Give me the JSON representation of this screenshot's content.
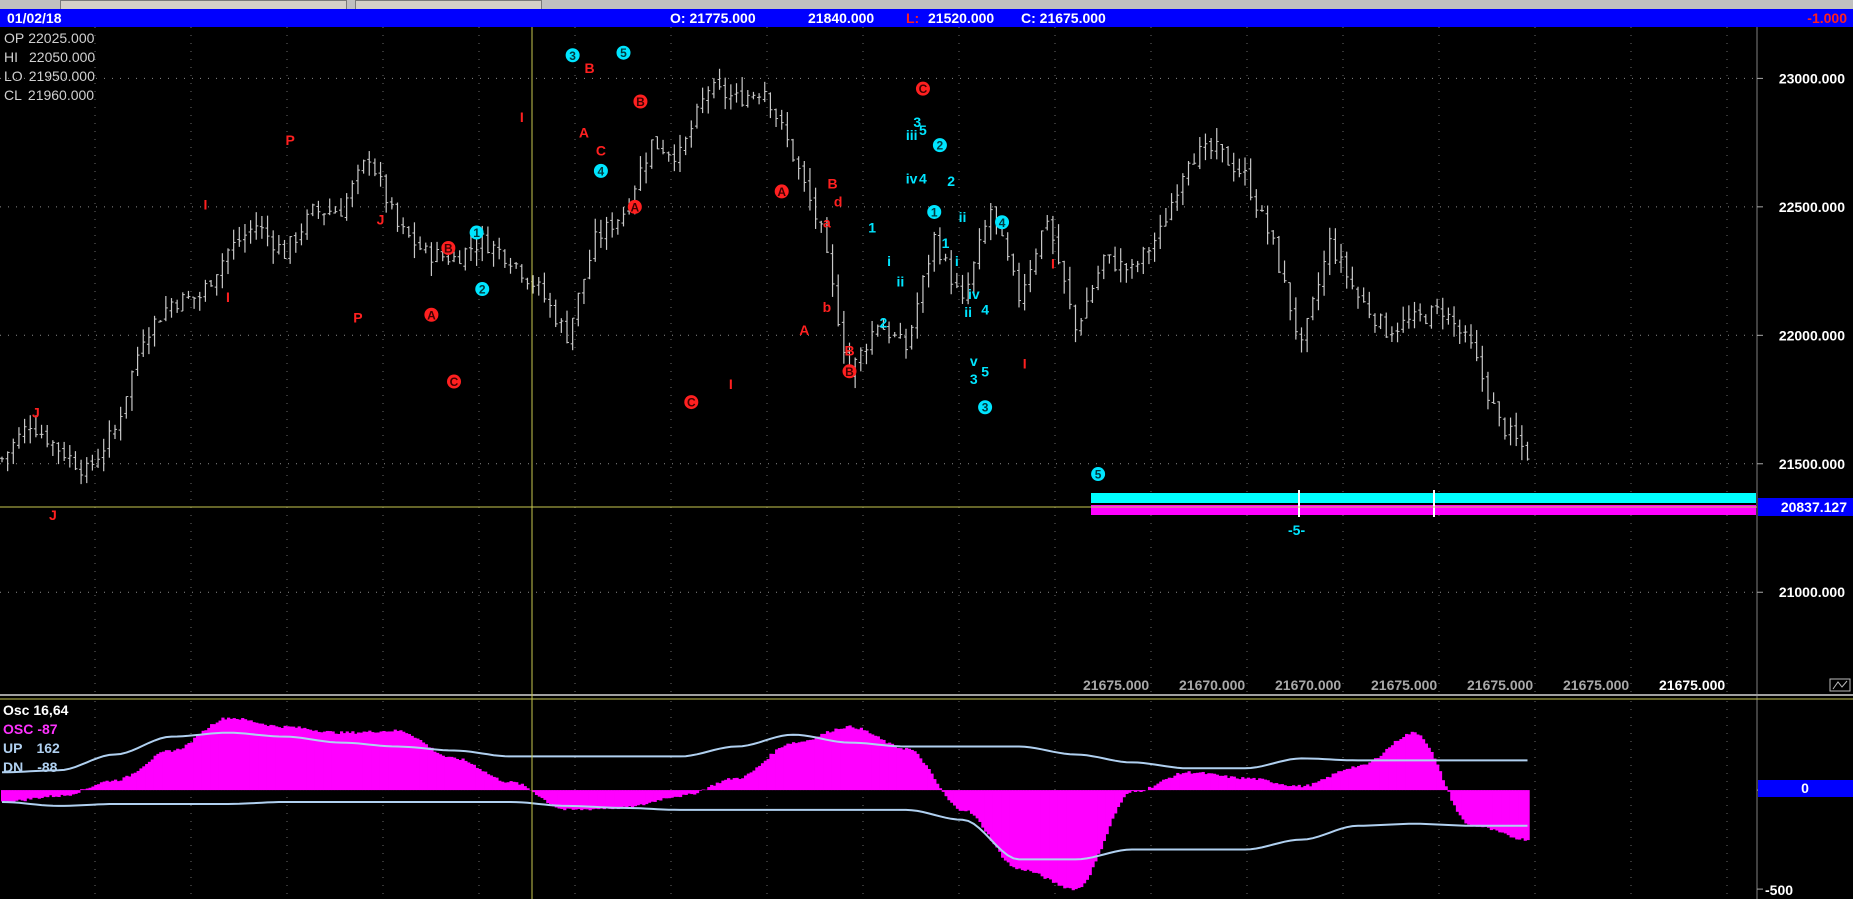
{
  "header": {
    "date": "01/02/18",
    "open": "O: 21775.000",
    "high": "21840.000",
    "low_label": "L:",
    "low": "21520.000",
    "close": "C: 21675.000",
    "change": "-1.000"
  },
  "info": [
    {
      "label": "OP",
      "value": "22025.000"
    },
    {
      "label": "HI",
      "value": "22050.000"
    },
    {
      "label": "LO",
      "value": "21950.000"
    },
    {
      "label": "CL",
      "value": "21960.000"
    }
  ],
  "bottom_values": [
    "21675.000",
    "21670.000",
    "21670.000",
    "21675.000",
    "21675.000",
    "21675.000",
    "21675.000"
  ],
  "osc_panel": {
    "title": "Osc 16,64",
    "rows": [
      {
        "label": "OSC",
        "value": "-87",
        "color": "#ff33ff"
      },
      {
        "label": "UP",
        "value": "162",
        "color": "#b0d0f0"
      },
      {
        "label": "DN",
        "value": "-88",
        "color": "#b0d0f0"
      }
    ],
    "zero_label": "0",
    "min_label": "-500"
  },
  "crosshair_price": "20837.127",
  "projection_label": "-5-",
  "colors": {
    "header_bg": "#0000ff",
    "price_bars": "#c8c8c8",
    "wave_red": "#ff2020",
    "wave_cyan": "#00e5ff",
    "osc_fill": "#ff00ff",
    "osc_bands": "#b0d0f0",
    "crosshair": "#c8c850"
  },
  "chart_data": [
    {
      "type": "line",
      "title": "",
      "ylim": [
        20600,
        23200
      ],
      "yticks": [
        "23000.000",
        "22500.000",
        "22000.000",
        "21500.000",
        "21000.000"
      ],
      "x": [
        0,
        5,
        10,
        15,
        20,
        25,
        30,
        35,
        40,
        45,
        50,
        55,
        60,
        65,
        70,
        75,
        80,
        85,
        90,
        95,
        100,
        105,
        110,
        115,
        120,
        125,
        130,
        135,
        140,
        145,
        150,
        155,
        160,
        165,
        170,
        175,
        180,
        185,
        190,
        195,
        200,
        205,
        210,
        215,
        220,
        225,
        230,
        235,
        240,
        245,
        250,
        255,
        260,
        265,
        270
      ],
      "series": [
        {
          "values": [
            21520,
            21660,
            21560,
            21470,
            21630,
            22000,
            22130,
            22150,
            22330,
            22430,
            22320,
            22480,
            22490,
            22700,
            22420,
            22320,
            22300,
            22370,
            22300,
            22180,
            22000,
            22370,
            22480,
            22750,
            22700,
            22960,
            22920,
            22960,
            22700,
            22400,
            21850,
            22050,
            21950,
            22380,
            22120,
            22490,
            22150,
            22460,
            22020,
            22300,
            22250,
            22400,
            22700,
            22720,
            22620,
            22350,
            21950,
            22360,
            22150,
            22020,
            22060,
            22100,
            21950,
            21660,
            21540
          ]
        }
      ]
    },
    {
      "type": "area",
      "title": "",
      "ylim": [
        -550,
        450
      ],
      "x": [
        0,
        10,
        20,
        30,
        40,
        50,
        60,
        70,
        80,
        90,
        100,
        110,
        120,
        130,
        140,
        150,
        160,
        170,
        180,
        190,
        200,
        210,
        220,
        230,
        240,
        250,
        260,
        270
      ],
      "series": [
        {
          "name": "OSC",
          "values": [
            -60,
            -30,
            50,
            200,
            365,
            320,
            290,
            300,
            160,
            40,
            -100,
            -90,
            -30,
            60,
            240,
            320,
            210,
            -100,
            -400,
            -500,
            -10,
            90,
            60,
            20,
            120,
            290,
            -180,
            -250
          ]
        },
        {
          "name": "UP",
          "values": [
            90,
            100,
            180,
            270,
            290,
            270,
            240,
            220,
            200,
            170,
            170,
            170,
            170,
            220,
            280,
            240,
            220,
            220,
            220,
            180,
            140,
            110,
            110,
            160,
            150,
            150,
            150,
            150
          ]
        },
        {
          "name": "DN",
          "values": [
            -60,
            -80,
            -70,
            -70,
            -70,
            -60,
            -60,
            -60,
            -60,
            -60,
            -80,
            -90,
            -100,
            -100,
            -100,
            -100,
            -100,
            -150,
            -350,
            -350,
            -300,
            -300,
            -300,
            -250,
            -180,
            -170,
            -180,
            -180
          ]
        }
      ],
      "zero": 0
    }
  ],
  "wave_labels": [
    {
      "text": "J",
      "x": 6,
      "y": 21700,
      "color": "red",
      "circle": false
    },
    {
      "text": "J",
      "x": 9,
      "y": 21300,
      "color": "red",
      "circle": false
    },
    {
      "text": "I",
      "x": 36,
      "y": 22510,
      "color": "red",
      "circle": false
    },
    {
      "text": "I",
      "x": 40,
      "y": 22150,
      "color": "red",
      "circle": false
    },
    {
      "text": "P",
      "x": 51,
      "y": 22760,
      "color": "red",
      "circle": false
    },
    {
      "text": "J",
      "x": 67,
      "y": 22450,
      "color": "red",
      "circle": false
    },
    {
      "text": "P",
      "x": 63,
      "y": 22070,
      "color": "red",
      "circle": false
    },
    {
      "text": "B",
      "x": 79,
      "y": 22340,
      "color": "red",
      "circle": true
    },
    {
      "text": "A",
      "x": 76,
      "y": 22080,
      "color": "red",
      "circle": true
    },
    {
      "text": "C",
      "x": 80,
      "y": 21820,
      "color": "red",
      "circle": true
    },
    {
      "text": "1",
      "x": 84,
      "y": 22400,
      "color": "cyan",
      "circle": true
    },
    {
      "text": "2",
      "x": 85,
      "y": 22180,
      "color": "cyan",
      "circle": true
    },
    {
      "text": "I",
      "x": 92,
      "y": 22850,
      "color": "red",
      "circle": false
    },
    {
      "text": "3",
      "x": 101,
      "y": 23090,
      "color": "cyan",
      "circle": true
    },
    {
      "text": "B",
      "x": 104,
      "y": 23040,
      "color": "red",
      "circle": false
    },
    {
      "text": "A",
      "x": 103,
      "y": 22790,
      "color": "red",
      "circle": false
    },
    {
      "text": "C",
      "x": 106,
      "y": 22720,
      "color": "red",
      "circle": false
    },
    {
      "text": "4",
      "x": 106,
      "y": 22640,
      "color": "cyan",
      "circle": true
    },
    {
      "text": "5",
      "x": 110,
      "y": 23100,
      "color": "cyan",
      "circle": true
    },
    {
      "text": "B",
      "x": 113,
      "y": 22910,
      "color": "red",
      "circle": true
    },
    {
      "text": "A",
      "x": 112,
      "y": 22500,
      "color": "red",
      "circle": true
    },
    {
      "text": "C",
      "x": 122,
      "y": 21740,
      "color": "red",
      "circle": true
    },
    {
      "text": "I",
      "x": 129,
      "y": 21810,
      "color": "red",
      "circle": false
    },
    {
      "text": "A",
      "x": 138,
      "y": 22560,
      "color": "red",
      "circle": true
    },
    {
      "text": "A",
      "x": 142,
      "y": 22020,
      "color": "red",
      "circle": false
    },
    {
      "text": "b",
      "x": 146,
      "y": 22110,
      "color": "red",
      "circle": false
    },
    {
      "text": "a",
      "x": 146,
      "y": 22440,
      "color": "red",
      "circle": false
    },
    {
      "text": "B",
      "x": 147,
      "y": 22590,
      "color": "red",
      "circle": false
    },
    {
      "text": "d",
      "x": 148,
      "y": 22520,
      "color": "red",
      "circle": false
    },
    {
      "text": "B",
      "x": 150,
      "y": 21940,
      "color": "red",
      "circle": false
    },
    {
      "text": "B",
      "x": 150,
      "y": 21860,
      "color": "red",
      "circle": true
    },
    {
      "text": "1",
      "x": 154,
      "y": 22420,
      "color": "cyan",
      "circle": false
    },
    {
      "text": "2",
      "x": 156,
      "y": 22050,
      "color": "cyan",
      "circle": false
    },
    {
      "text": "i",
      "x": 157,
      "y": 22290,
      "color": "cyan",
      "circle": false
    },
    {
      "text": "ii",
      "x": 159,
      "y": 22210,
      "color": "cyan",
      "circle": false
    },
    {
      "text": "C",
      "x": 163,
      "y": 22960,
      "color": "red",
      "circle": true
    },
    {
      "text": "3",
      "x": 162,
      "y": 22830,
      "color": "cyan",
      "circle": false
    },
    {
      "text": "5",
      "x": 163,
      "y": 22800,
      "color": "cyan",
      "circle": false
    },
    {
      "text": "iii",
      "x": 161,
      "y": 22780,
      "color": "cyan",
      "circle": false
    },
    {
      "text": "2",
      "x": 166,
      "y": 22740,
      "color": "cyan",
      "circle": true
    },
    {
      "text": "iv",
      "x": 161,
      "y": 22610,
      "color": "cyan",
      "circle": false
    },
    {
      "text": "4",
      "x": 163,
      "y": 22610,
      "color": "cyan",
      "circle": false
    },
    {
      "text": "2",
      "x": 168,
      "y": 22600,
      "color": "cyan",
      "circle": false
    },
    {
      "text": "1",
      "x": 165,
      "y": 22480,
      "color": "cyan",
      "circle": true
    },
    {
      "text": "ii",
      "x": 170,
      "y": 22460,
      "color": "cyan",
      "circle": false
    },
    {
      "text": "1",
      "x": 167,
      "y": 22360,
      "color": "cyan",
      "circle": false
    },
    {
      "text": "i",
      "x": 169,
      "y": 22290,
      "color": "cyan",
      "circle": false
    },
    {
      "text": "iv",
      "x": 172,
      "y": 22160,
      "color": "cyan",
      "circle": false
    },
    {
      "text": "ii",
      "x": 171,
      "y": 22090,
      "color": "cyan",
      "circle": false
    },
    {
      "text": "4",
      "x": 174,
      "y": 22100,
      "color": "cyan",
      "circle": false
    },
    {
      "text": "v",
      "x": 172,
      "y": 21900,
      "color": "cyan",
      "circle": false
    },
    {
      "text": "5",
      "x": 174,
      "y": 21860,
      "color": "cyan",
      "circle": false
    },
    {
      "text": "3",
      "x": 172,
      "y": 21830,
      "color": "cyan",
      "circle": false
    },
    {
      "text": "3",
      "x": 174,
      "y": 21720,
      "color": "cyan",
      "circle": true
    },
    {
      "text": "4",
      "x": 177,
      "y": 22440,
      "color": "cyan",
      "circle": true
    },
    {
      "text": "I",
      "x": 186,
      "y": 22280,
      "color": "red",
      "circle": false
    },
    {
      "text": "I",
      "x": 181,
      "y": 21890,
      "color": "red",
      "circle": false
    },
    {
      "text": "5",
      "x": 194,
      "y": 21460,
      "color": "cyan",
      "circle": true
    }
  ]
}
